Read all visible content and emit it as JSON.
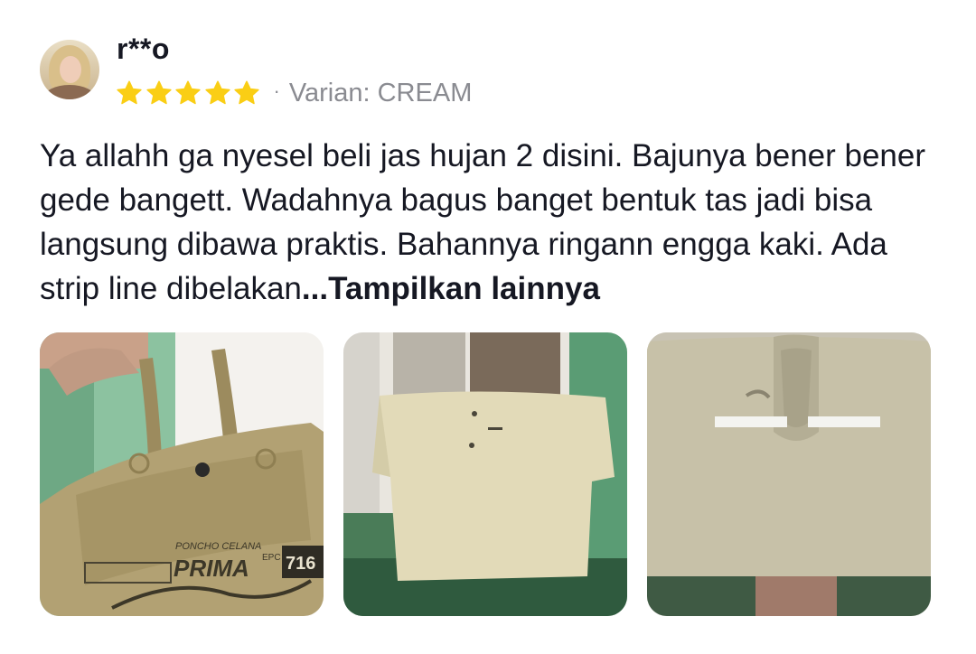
{
  "reviewer": {
    "name": "r**o",
    "avatar_icon": "user-avatar-photo"
  },
  "rating": {
    "stars": 5,
    "max": 5,
    "star_color": "#FACE15",
    "separator": "·",
    "variant_label": "Varian: CREAM"
  },
  "review": {
    "text": "Ya allahh ga nyesel beli jas hujan 2 disini. Bajunya bener bener gede bangett. Wadahnya bagus banget bentuk tas jadi bisa langsung dibawa praktis. Bahannya ringann engga kaki. Ada strip line dibelakan",
    "ellipsis": "...",
    "more_label": "Tampilkan lainnya"
  },
  "photos": [
    {
      "icon": "bag-photo",
      "bag_text": "PONCHO CELANA",
      "brand": "PRIMA",
      "badge": "EPC",
      "number": "716"
    },
    {
      "icon": "raincoat-front-photo"
    },
    {
      "icon": "raincoat-back-photo"
    }
  ]
}
